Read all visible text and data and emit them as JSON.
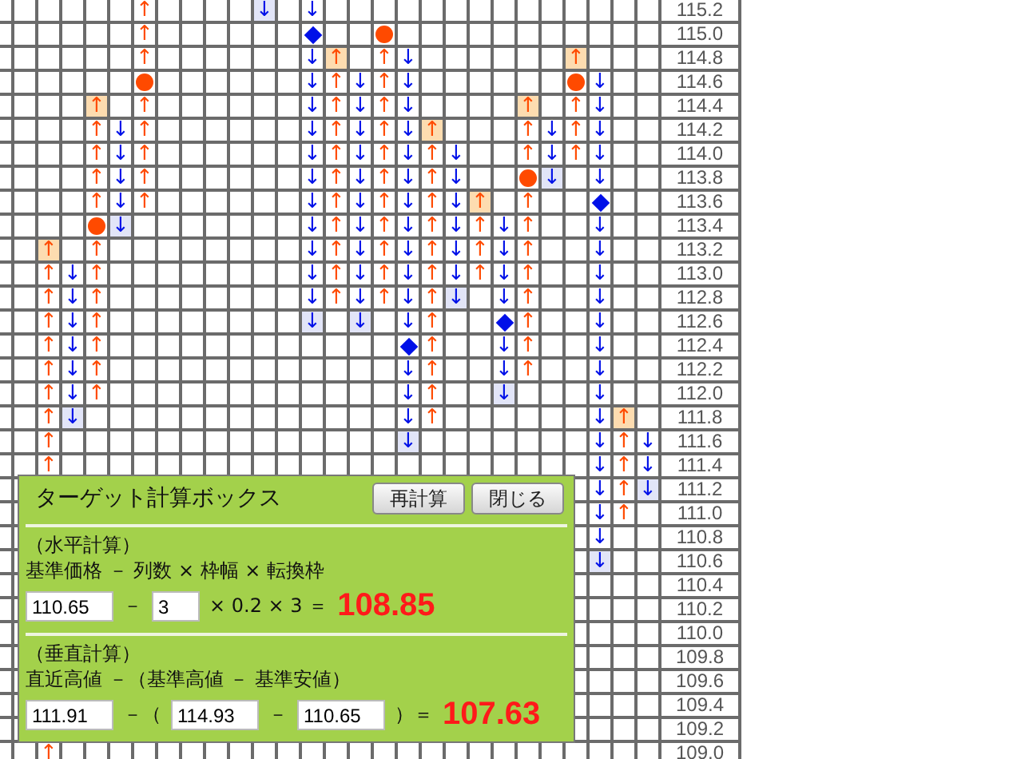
{
  "chart": {
    "prices": [
      "115.2",
      "115.0",
      "114.8",
      "114.6",
      "114.4",
      "114.2",
      "114.0",
      "113.8",
      "113.6",
      "113.4",
      "113.2",
      "113.0",
      "112.8",
      "112.6",
      "112.4",
      "112.2",
      "112.0",
      "111.8",
      "111.6",
      "111.4",
      "111.2",
      "111.0",
      "110.8",
      "110.6",
      "110.4",
      "110.2",
      "110.0",
      "109.8",
      "109.6",
      "109.4",
      "109.2",
      "109.0"
    ],
    "columns": [
      {
        "kind": "blank"
      },
      {
        "kind": "filled",
        "cells": [
          {
            "kind": "gap"
          },
          {
            "kind": "gap"
          },
          {
            "kind": "gap"
          },
          {
            "kind": "gap"
          },
          {
            "kind": "gap"
          },
          {
            "kind": "gap"
          },
          {
            "kind": "gap"
          },
          {
            "kind": "gap"
          },
          {
            "kind": "gap"
          },
          {
            "kind": "gap"
          },
          {
            "kind": "up",
            "text": "↑",
            "highlighted": true
          },
          {
            "kind": "up",
            "text": "↑",
            "highlighted": false
          },
          {
            "kind": "up",
            "text": "↑",
            "highlighted": false
          },
          {
            "kind": "up",
            "text": "↑",
            "highlighted": false
          },
          {
            "kind": "up",
            "text": "↑",
            "highlighted": false
          },
          {
            "kind": "up",
            "text": "↑",
            "highlighted": false
          },
          {
            "kind": "up",
            "text": "↑",
            "highlighted": false
          },
          {
            "kind": "up",
            "text": "↑",
            "highlighted": false
          },
          {
            "kind": "up",
            "text": "↑",
            "highlighted": false
          },
          {
            "kind": "up",
            "text": "↑",
            "highlighted": false
          },
          {
            "kind": "gap"
          },
          {
            "kind": "gap"
          },
          {
            "kind": "gap"
          },
          {
            "kind": "gap"
          },
          {
            "kind": "gap"
          },
          {
            "kind": "gap"
          },
          {
            "kind": "gap"
          },
          {
            "kind": "gap"
          },
          {
            "kind": "gap"
          },
          {
            "kind": "gap"
          },
          {
            "kind": "gap"
          },
          {
            "kind": "up",
            "text": "↑",
            "highlighted": false
          }
        ]
      },
      {
        "kind": "filled",
        "cells": [
          {
            "kind": "gap"
          },
          {
            "kind": "gap"
          },
          {
            "kind": "gap"
          },
          {
            "kind": "gap"
          },
          {
            "kind": "gap"
          },
          {
            "kind": "gap"
          },
          {
            "kind": "gap"
          },
          {
            "kind": "gap"
          },
          {
            "kind": "gap"
          },
          {
            "kind": "gap"
          },
          {
            "kind": "gap"
          },
          {
            "kind": "down",
            "text": "↓",
            "highlighted": false
          },
          {
            "kind": "down",
            "text": "↓",
            "highlighted": false
          },
          {
            "kind": "down",
            "text": "↓",
            "highlighted": false
          },
          {
            "kind": "down",
            "text": "↓",
            "highlighted": false
          },
          {
            "kind": "down",
            "text": "↓",
            "highlighted": false
          },
          {
            "kind": "down",
            "text": "↓",
            "highlighted": false
          },
          {
            "kind": "down",
            "text": "↓",
            "highlighted": true
          }
        ]
      },
      {
        "kind": "filled",
        "cells": [
          {
            "kind": "gap"
          },
          {
            "kind": "gap"
          },
          {
            "kind": "gap"
          },
          {
            "kind": "gap"
          },
          {
            "kind": "up",
            "text": "↑",
            "highlighted": true
          },
          {
            "kind": "up",
            "text": "↑",
            "highlighted": false
          },
          {
            "kind": "up",
            "text": "↑",
            "highlighted": false
          },
          {
            "kind": "up",
            "text": "↑",
            "highlighted": false
          },
          {
            "kind": "up",
            "text": "↑",
            "highlighted": false
          },
          {
            "kind": "circle"
          },
          {
            "kind": "up",
            "text": "↑",
            "highlighted": false
          },
          {
            "kind": "up",
            "text": "↑",
            "highlighted": false
          },
          {
            "kind": "up",
            "text": "↑",
            "highlighted": false
          },
          {
            "kind": "up",
            "text": "↑",
            "highlighted": false
          },
          {
            "kind": "up",
            "text": "↑",
            "highlighted": false
          },
          {
            "kind": "up",
            "text": "↑",
            "highlighted": false
          },
          {
            "kind": "up",
            "text": "↑",
            "highlighted": false
          }
        ]
      },
      {
        "kind": "filled",
        "cells": [
          {
            "kind": "gap"
          },
          {
            "kind": "gap"
          },
          {
            "kind": "gap"
          },
          {
            "kind": "gap"
          },
          {
            "kind": "gap"
          },
          {
            "kind": "down",
            "text": "↓",
            "highlighted": false
          },
          {
            "kind": "down",
            "text": "↓",
            "highlighted": false
          },
          {
            "kind": "down",
            "text": "↓",
            "highlighted": false
          },
          {
            "kind": "down",
            "text": "↓",
            "highlighted": false
          },
          {
            "kind": "down",
            "text": "↓",
            "highlighted": true
          }
        ]
      },
      {
        "kind": "filled",
        "cells": [
          {
            "kind": "up",
            "text": "↑",
            "highlighted": false
          },
          {
            "kind": "up",
            "text": "↑",
            "highlighted": false
          },
          {
            "kind": "up",
            "text": "↑",
            "highlighted": false
          },
          {
            "kind": "circle"
          },
          {
            "kind": "up",
            "text": "↑",
            "highlighted": false
          },
          {
            "kind": "up",
            "text": "↑",
            "highlighted": false
          },
          {
            "kind": "up",
            "text": "↑",
            "highlighted": false
          },
          {
            "kind": "up",
            "text": "↑",
            "highlighted": false
          },
          {
            "kind": "up",
            "text": "↑",
            "highlighted": false
          }
        ]
      },
      {
        "kind": "blank"
      },
      {
        "kind": "blank"
      },
      {
        "kind": "blank"
      },
      {
        "kind": "blank"
      },
      {
        "kind": "filled",
        "cells": [
          {
            "kind": "down",
            "text": "↓",
            "highlighted": true
          }
        ]
      },
      {
        "kind": "blank"
      },
      {
        "kind": "filled",
        "cells": [
          {
            "kind": "down",
            "text": "↓",
            "highlighted": false
          },
          {
            "kind": "diamond"
          },
          {
            "kind": "down",
            "text": "↓",
            "highlighted": false
          },
          {
            "kind": "down",
            "text": "↓",
            "highlighted": false
          },
          {
            "kind": "down",
            "text": "↓",
            "highlighted": false
          },
          {
            "kind": "down",
            "text": "↓",
            "highlighted": false
          },
          {
            "kind": "down",
            "text": "↓",
            "highlighted": false
          },
          {
            "kind": "down",
            "text": "↓",
            "highlighted": false
          },
          {
            "kind": "down",
            "text": "↓",
            "highlighted": false
          },
          {
            "kind": "down",
            "text": "↓",
            "highlighted": false
          },
          {
            "kind": "down",
            "text": "↓",
            "highlighted": false
          },
          {
            "kind": "down",
            "text": "↓",
            "highlighted": false
          },
          {
            "kind": "down",
            "text": "↓",
            "highlighted": false
          },
          {
            "kind": "down",
            "text": "↓",
            "highlighted": true
          }
        ]
      },
      {
        "kind": "filled",
        "cells": [
          {
            "kind": "gap"
          },
          {
            "kind": "gap"
          },
          {
            "kind": "up",
            "text": "↑",
            "highlighted": true
          },
          {
            "kind": "up",
            "text": "↑",
            "highlighted": false
          },
          {
            "kind": "up",
            "text": "↑",
            "highlighted": false
          },
          {
            "kind": "up",
            "text": "↑",
            "highlighted": false
          },
          {
            "kind": "up",
            "text": "↑",
            "highlighted": false
          },
          {
            "kind": "up",
            "text": "↑",
            "highlighted": false
          },
          {
            "kind": "up",
            "text": "↑",
            "highlighted": false
          },
          {
            "kind": "up",
            "text": "↑",
            "highlighted": false
          },
          {
            "kind": "up",
            "text": "↑",
            "highlighted": false
          },
          {
            "kind": "up",
            "text": "↑",
            "highlighted": false
          },
          {
            "kind": "up",
            "text": "↑",
            "highlighted": false
          }
        ]
      },
      {
        "kind": "filled",
        "cells": [
          {
            "kind": "gap"
          },
          {
            "kind": "gap"
          },
          {
            "kind": "gap"
          },
          {
            "kind": "down",
            "text": "↓",
            "highlighted": false
          },
          {
            "kind": "down",
            "text": "↓",
            "highlighted": false
          },
          {
            "kind": "down",
            "text": "↓",
            "highlighted": false
          },
          {
            "kind": "down",
            "text": "↓",
            "highlighted": false
          },
          {
            "kind": "down",
            "text": "↓",
            "highlighted": false
          },
          {
            "kind": "down",
            "text": "↓",
            "highlighted": false
          },
          {
            "kind": "down",
            "text": "↓",
            "highlighted": false
          },
          {
            "kind": "down",
            "text": "↓",
            "highlighted": false
          },
          {
            "kind": "down",
            "text": "↓",
            "highlighted": false
          },
          {
            "kind": "down",
            "text": "↓",
            "highlighted": false
          },
          {
            "kind": "down",
            "text": "↓",
            "highlighted": true
          }
        ]
      },
      {
        "kind": "filled",
        "cells": [
          {
            "kind": "gap"
          },
          {
            "kind": "circle"
          },
          {
            "kind": "up",
            "text": "↑",
            "highlighted": false
          },
          {
            "kind": "up",
            "text": "↑",
            "highlighted": false
          },
          {
            "kind": "up",
            "text": "↑",
            "highlighted": false
          },
          {
            "kind": "up",
            "text": "↑",
            "highlighted": false
          },
          {
            "kind": "up",
            "text": "↑",
            "highlighted": false
          },
          {
            "kind": "up",
            "text": "↑",
            "highlighted": false
          },
          {
            "kind": "up",
            "text": "↑",
            "highlighted": false
          },
          {
            "kind": "up",
            "text": "↑",
            "highlighted": false
          },
          {
            "kind": "up",
            "text": "↑",
            "highlighted": false
          },
          {
            "kind": "up",
            "text": "↑",
            "highlighted": false
          },
          {
            "kind": "up",
            "text": "↑",
            "highlighted": false
          }
        ]
      },
      {
        "kind": "filled",
        "cells": [
          {
            "kind": "gap"
          },
          {
            "kind": "gap"
          },
          {
            "kind": "down",
            "text": "↓",
            "highlighted": false
          },
          {
            "kind": "down",
            "text": "↓",
            "highlighted": false
          },
          {
            "kind": "down",
            "text": "↓",
            "highlighted": false
          },
          {
            "kind": "down",
            "text": "↓",
            "highlighted": false
          },
          {
            "kind": "down",
            "text": "↓",
            "highlighted": false
          },
          {
            "kind": "down",
            "text": "↓",
            "highlighted": false
          },
          {
            "kind": "down",
            "text": "↓",
            "highlighted": false
          },
          {
            "kind": "down",
            "text": "↓",
            "highlighted": false
          },
          {
            "kind": "down",
            "text": "↓",
            "highlighted": false
          },
          {
            "kind": "down",
            "text": "↓",
            "highlighted": false
          },
          {
            "kind": "down",
            "text": "↓",
            "highlighted": false
          },
          {
            "kind": "down",
            "text": "↓",
            "highlighted": false
          },
          {
            "kind": "diamond"
          },
          {
            "kind": "down",
            "text": "↓",
            "highlighted": false
          },
          {
            "kind": "down",
            "text": "↓",
            "highlighted": false
          },
          {
            "kind": "down",
            "text": "↓",
            "highlighted": false
          },
          {
            "kind": "down",
            "text": "↓",
            "highlighted": true
          }
        ]
      },
      {
        "kind": "filled",
        "cells": [
          {
            "kind": "gap"
          },
          {
            "kind": "gap"
          },
          {
            "kind": "gap"
          },
          {
            "kind": "gap"
          },
          {
            "kind": "gap"
          },
          {
            "kind": "up",
            "text": "↑",
            "highlighted": true
          },
          {
            "kind": "up",
            "text": "↑",
            "highlighted": false
          },
          {
            "kind": "up",
            "text": "↑",
            "highlighted": false
          },
          {
            "kind": "up",
            "text": "↑",
            "highlighted": false
          },
          {
            "kind": "up",
            "text": "↑",
            "highlighted": false
          },
          {
            "kind": "up",
            "text": "↑",
            "highlighted": false
          },
          {
            "kind": "up",
            "text": "↑",
            "highlighted": false
          },
          {
            "kind": "up",
            "text": "↑",
            "highlighted": false
          },
          {
            "kind": "up",
            "text": "↑",
            "highlighted": false
          },
          {
            "kind": "up",
            "text": "↑",
            "highlighted": false
          },
          {
            "kind": "up",
            "text": "↑",
            "highlighted": false
          },
          {
            "kind": "up",
            "text": "↑",
            "highlighted": false
          },
          {
            "kind": "up",
            "text": "↑",
            "highlighted": false
          }
        ]
      },
      {
        "kind": "filled",
        "cells": [
          {
            "kind": "gap"
          },
          {
            "kind": "gap"
          },
          {
            "kind": "gap"
          },
          {
            "kind": "gap"
          },
          {
            "kind": "gap"
          },
          {
            "kind": "gap"
          },
          {
            "kind": "down",
            "text": "↓",
            "highlighted": false
          },
          {
            "kind": "down",
            "text": "↓",
            "highlighted": false
          },
          {
            "kind": "down",
            "text": "↓",
            "highlighted": false
          },
          {
            "kind": "down",
            "text": "↓",
            "highlighted": false
          },
          {
            "kind": "down",
            "text": "↓",
            "highlighted": false
          },
          {
            "kind": "down",
            "text": "↓",
            "highlighted": false
          },
          {
            "kind": "down",
            "text": "↓",
            "highlighted": true
          }
        ]
      },
      {
        "kind": "filled",
        "cells": [
          {
            "kind": "gap"
          },
          {
            "kind": "gap"
          },
          {
            "kind": "gap"
          },
          {
            "kind": "gap"
          },
          {
            "kind": "gap"
          },
          {
            "kind": "gap"
          },
          {
            "kind": "gap"
          },
          {
            "kind": "gap"
          },
          {
            "kind": "up",
            "text": "↑",
            "highlighted": true
          },
          {
            "kind": "up",
            "text": "↑",
            "highlighted": false
          },
          {
            "kind": "up",
            "text": "↑",
            "highlighted": false
          },
          {
            "kind": "up",
            "text": "↑",
            "highlighted": false
          }
        ]
      },
      {
        "kind": "filled",
        "cells": [
          {
            "kind": "gap"
          },
          {
            "kind": "gap"
          },
          {
            "kind": "gap"
          },
          {
            "kind": "gap"
          },
          {
            "kind": "gap"
          },
          {
            "kind": "gap"
          },
          {
            "kind": "gap"
          },
          {
            "kind": "gap"
          },
          {
            "kind": "gap"
          },
          {
            "kind": "down",
            "text": "↓",
            "highlighted": false
          },
          {
            "kind": "down",
            "text": "↓",
            "highlighted": false
          },
          {
            "kind": "down",
            "text": "↓",
            "highlighted": false
          },
          {
            "kind": "down",
            "text": "↓",
            "highlighted": false
          },
          {
            "kind": "diamond"
          },
          {
            "kind": "down",
            "text": "↓",
            "highlighted": false
          },
          {
            "kind": "down",
            "text": "↓",
            "highlighted": false
          },
          {
            "kind": "down",
            "text": "↓",
            "highlighted": true
          }
        ]
      },
      {
        "kind": "filled",
        "cells": [
          {
            "kind": "gap"
          },
          {
            "kind": "gap"
          },
          {
            "kind": "gap"
          },
          {
            "kind": "gap"
          },
          {
            "kind": "up",
            "text": "↑",
            "highlighted": true
          },
          {
            "kind": "up",
            "text": "↑",
            "highlighted": false
          },
          {
            "kind": "up",
            "text": "↑",
            "highlighted": false
          },
          {
            "kind": "circle"
          },
          {
            "kind": "up",
            "text": "↑",
            "highlighted": false
          },
          {
            "kind": "up",
            "text": "↑",
            "highlighted": false
          },
          {
            "kind": "up",
            "text": "↑",
            "highlighted": false
          },
          {
            "kind": "up",
            "text": "↑",
            "highlighted": false
          },
          {
            "kind": "up",
            "text": "↑",
            "highlighted": false
          },
          {
            "kind": "up",
            "text": "↑",
            "highlighted": false
          },
          {
            "kind": "up",
            "text": "↑",
            "highlighted": false
          },
          {
            "kind": "up",
            "text": "↑",
            "highlighted": false
          }
        ]
      },
      {
        "kind": "filled",
        "cells": [
          {
            "kind": "gap"
          },
          {
            "kind": "gap"
          },
          {
            "kind": "gap"
          },
          {
            "kind": "gap"
          },
          {
            "kind": "gap"
          },
          {
            "kind": "down",
            "text": "↓",
            "highlighted": false
          },
          {
            "kind": "down",
            "text": "↓",
            "highlighted": false
          },
          {
            "kind": "down",
            "text": "↓",
            "highlighted": true
          }
        ]
      },
      {
        "kind": "filled",
        "cells": [
          {
            "kind": "gap"
          },
          {
            "kind": "gap"
          },
          {
            "kind": "up",
            "text": "↑",
            "highlighted": true
          },
          {
            "kind": "circle"
          },
          {
            "kind": "up",
            "text": "↑",
            "highlighted": false
          },
          {
            "kind": "up",
            "text": "↑",
            "highlighted": false
          },
          {
            "kind": "up",
            "text": "↑",
            "highlighted": false
          }
        ]
      },
      {
        "kind": "filled",
        "cells": [
          {
            "kind": "gap"
          },
          {
            "kind": "gap"
          },
          {
            "kind": "gap"
          },
          {
            "kind": "down",
            "text": "↓",
            "highlighted": false
          },
          {
            "kind": "down",
            "text": "↓",
            "highlighted": false
          },
          {
            "kind": "down",
            "text": "↓",
            "highlighted": false
          },
          {
            "kind": "down",
            "text": "↓",
            "highlighted": false
          },
          {
            "kind": "down",
            "text": "↓",
            "highlighted": false
          },
          {
            "kind": "diamond"
          },
          {
            "kind": "down",
            "text": "↓",
            "highlighted": false
          },
          {
            "kind": "down",
            "text": "↓",
            "highlighted": false
          },
          {
            "kind": "down",
            "text": "↓",
            "highlighted": false
          },
          {
            "kind": "down",
            "text": "↓",
            "highlighted": false
          },
          {
            "kind": "down",
            "text": "↓",
            "highlighted": false
          },
          {
            "kind": "down",
            "text": "↓",
            "highlighted": false
          },
          {
            "kind": "down",
            "text": "↓",
            "highlighted": false
          },
          {
            "kind": "down",
            "text": "↓",
            "highlighted": false
          },
          {
            "kind": "down",
            "text": "↓",
            "highlighted": false
          },
          {
            "kind": "down",
            "text": "↓",
            "highlighted": false
          },
          {
            "kind": "down",
            "text": "↓",
            "highlighted": false
          },
          {
            "kind": "down",
            "text": "↓",
            "highlighted": false
          },
          {
            "kind": "down",
            "text": "↓",
            "highlighted": false
          },
          {
            "kind": "down",
            "text": "↓",
            "highlighted": false
          },
          {
            "kind": "down",
            "text": "↓",
            "highlighted": true
          }
        ]
      },
      {
        "kind": "filled",
        "cells": [
          {
            "kind": "gap"
          },
          {
            "kind": "gap"
          },
          {
            "kind": "gap"
          },
          {
            "kind": "gap"
          },
          {
            "kind": "gap"
          },
          {
            "kind": "gap"
          },
          {
            "kind": "gap"
          },
          {
            "kind": "gap"
          },
          {
            "kind": "gap"
          },
          {
            "kind": "gap"
          },
          {
            "kind": "gap"
          },
          {
            "kind": "gap"
          },
          {
            "kind": "gap"
          },
          {
            "kind": "gap"
          },
          {
            "kind": "gap"
          },
          {
            "kind": "gap"
          },
          {
            "kind": "gap"
          },
          {
            "kind": "up",
            "text": "↑",
            "highlighted": true
          },
          {
            "kind": "up",
            "text": "↑",
            "highlighted": false
          },
          {
            "kind": "up",
            "text": "↑",
            "highlighted": false
          },
          {
            "kind": "up",
            "text": "↑",
            "highlighted": false
          },
          {
            "kind": "up",
            "text": "↑",
            "highlighted": false
          }
        ]
      },
      {
        "kind": "filled",
        "cells": [
          {
            "kind": "gap"
          },
          {
            "kind": "gap"
          },
          {
            "kind": "gap"
          },
          {
            "kind": "gap"
          },
          {
            "kind": "gap"
          },
          {
            "kind": "gap"
          },
          {
            "kind": "gap"
          },
          {
            "kind": "gap"
          },
          {
            "kind": "gap"
          },
          {
            "kind": "gap"
          },
          {
            "kind": "gap"
          },
          {
            "kind": "gap"
          },
          {
            "kind": "gap"
          },
          {
            "kind": "gap"
          },
          {
            "kind": "gap"
          },
          {
            "kind": "gap"
          },
          {
            "kind": "gap"
          },
          {
            "kind": "gap"
          },
          {
            "kind": "down",
            "text": "↓",
            "highlighted": false
          },
          {
            "kind": "down",
            "text": "↓",
            "highlighted": false
          },
          {
            "kind": "down",
            "text": "↓",
            "highlighted": true
          }
        ]
      }
    ]
  },
  "target_box": {
    "title": "ターゲット計算ボックス",
    "buttons": [
      {
        "label": "再計算"
      },
      {
        "label": "閉じる"
      }
    ],
    "sections": [
      {
        "heading": "（水平計算）",
        "formula": "基準価格 － 列数 × 枠幅 × 転換枠",
        "parts": [
          {
            "kind": "field",
            "value": "110.65"
          },
          {
            "kind": "text",
            "text": "－"
          },
          {
            "kind": "small_field",
            "value": "3"
          },
          {
            "kind": "text",
            "text": "× 0.2 × 3 ＝"
          },
          {
            "kind": "result",
            "text": "108.85"
          }
        ]
      },
      {
        "heading": "（垂直計算）",
        "formula": "直近高値 －（基準高値 － 基準安値）",
        "parts": [
          {
            "kind": "field",
            "value": "111.91"
          },
          {
            "kind": "text",
            "text": "－（"
          },
          {
            "kind": "field",
            "value": "114.93"
          },
          {
            "kind": "text",
            "text": "－"
          },
          {
            "kind": "field",
            "value": "110.65"
          },
          {
            "kind": "text",
            "text": "）＝"
          },
          {
            "kind": "result",
            "text": "107.63"
          }
        ]
      }
    ]
  }
}
